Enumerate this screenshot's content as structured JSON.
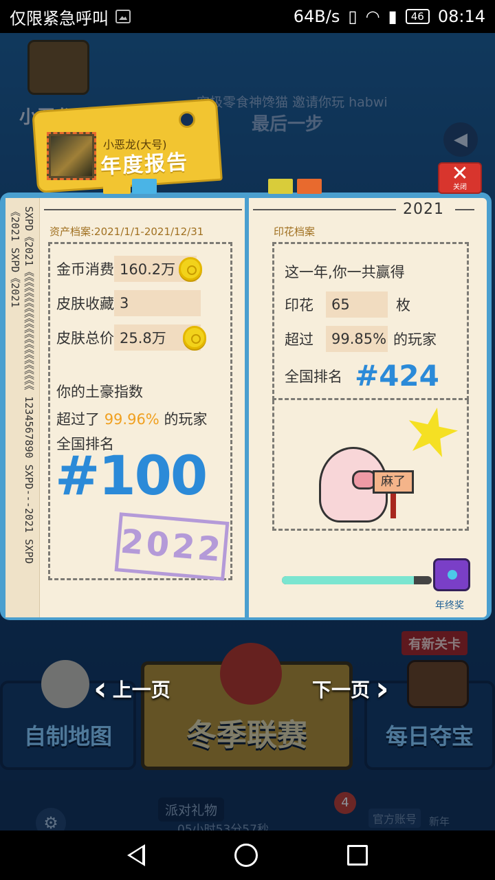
{
  "status_bar": {
    "emergency_text": "仅限紧急呼叫",
    "network_speed": "64B/s",
    "battery": "46",
    "time": "08:14"
  },
  "background": {
    "user_name": "小恶龙(大",
    "notice": "究极零食神馋猫 邀请你玩 habwi",
    "last_step": "最后一步",
    "menu_left": "自制地图",
    "menu_center": "冬季联赛",
    "menu_right": "每日夺宝",
    "new_level_badge": "有新关卡",
    "party_gift": "派对礼物",
    "party_timer": "05小时53分57秒",
    "official_account": "官方账号",
    "new_year_card": "新年",
    "badge_count": "4"
  },
  "report": {
    "tag_user_name": "小恶龙(大号)",
    "tag_title": "年度报告",
    "close_label": "关闭",
    "spine_text": "SXPD《2021《《《《《《《《《《《《《《《《《《《《《《《 1234567890 SXPD---2021 SXPD《2021 SXPD《2021",
    "year": "2021",
    "left_page": {
      "heading": "资产档案:2021/1/1-2021/12/31",
      "coins_label": "金币消费",
      "coins_value": "160.2万",
      "skins_label": "皮肤收藏",
      "skins_value": "3",
      "skin_total_label": "皮肤总价",
      "skin_total_value": "25.8万",
      "wealth_title": "你的土豪指数",
      "beat_prefix": "超过了",
      "beat_percent": "99.96%",
      "beat_suffix": "的玩家",
      "rank_label": "全国排名",
      "rank_value": "#100",
      "stamp_text": "2022"
    },
    "right_page": {
      "heading": "印花档案",
      "intro": "这一年,你一共赢得",
      "stamps_label": "印花",
      "stamps_value": "65",
      "stamps_unit": "枚",
      "beat_label": "超过",
      "beat_percent": "99.85%",
      "beat_suffix": "的玩家",
      "rank_label": "全国排名",
      "rank_value": "#424",
      "pig_sign": "麻了",
      "progress": 0.88,
      "reward_label": "年终奖"
    }
  },
  "nav": {
    "prev_label": "上一页",
    "next_label": "下一页"
  },
  "colors": {
    "accent_blue": "#2b8ad8",
    "gold_text": "#f0a020",
    "close_red": "#d8352d",
    "progress_fill": "#7be5d0"
  }
}
